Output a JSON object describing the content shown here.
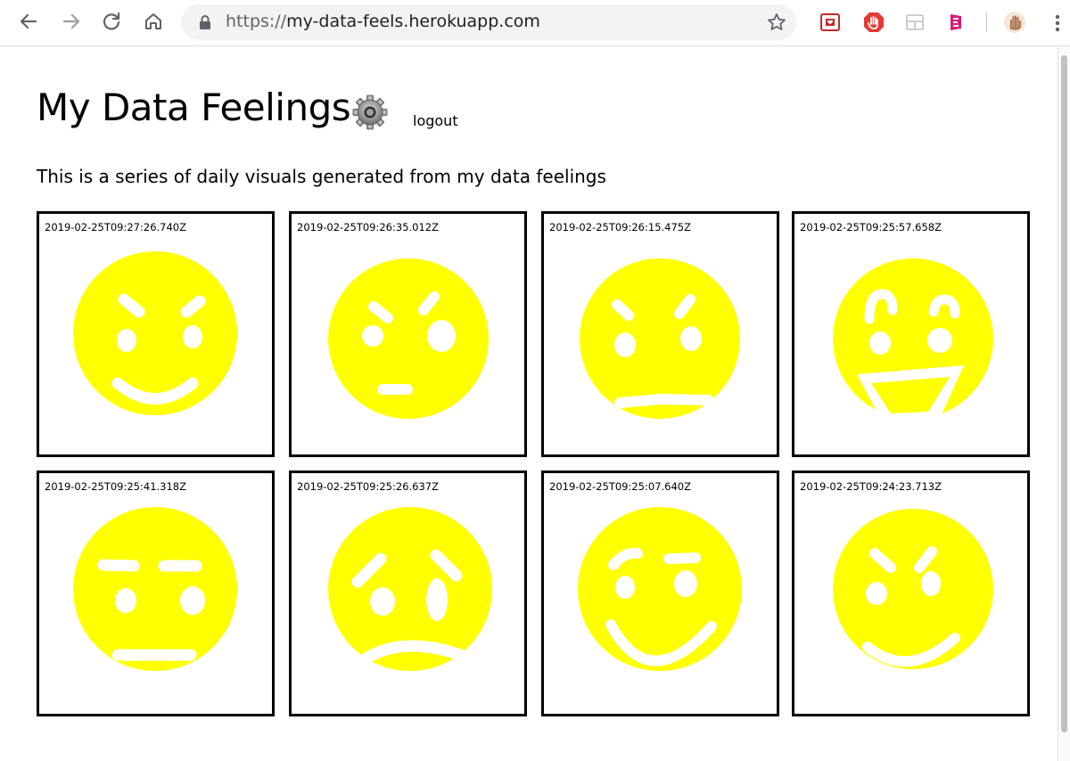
{
  "browser": {
    "url_scheme": "https://",
    "url_host": "my-data-feels.herokuapp.com",
    "icons": [
      "back-icon",
      "forward-icon",
      "reload-icon",
      "home-icon",
      "lock-icon",
      "star-icon",
      "menu-icon"
    ]
  },
  "page": {
    "title": "My Data Feelings",
    "logout_label": "logout",
    "subtitle": "This is a series of daily visuals generated from my data feelings"
  },
  "colors": {
    "face": "#ffff00",
    "feature": "#ffffff",
    "border": "#000000"
  },
  "entries": [
    {
      "timestamp": "2019-02-25T09:27:26.740Z",
      "mood": "smile-angry-brows"
    },
    {
      "timestamp": "2019-02-25T09:26:35.012Z",
      "mood": "neutral-small-mouth"
    },
    {
      "timestamp": "2019-02-25T09:26:15.475Z",
      "mood": "grimace"
    },
    {
      "timestamp": "2019-02-25T09:25:57.658Z",
      "mood": "laughing"
    },
    {
      "timestamp": "2019-02-25T09:25:41.318Z",
      "mood": "flat"
    },
    {
      "timestamp": "2019-02-25T09:25:26.637Z",
      "mood": "sad"
    },
    {
      "timestamp": "2019-02-25T09:25:07.640Z",
      "mood": "happy"
    },
    {
      "timestamp": "2019-02-25T09:24:23.713Z",
      "mood": "smile-angry-brows"
    }
  ]
}
